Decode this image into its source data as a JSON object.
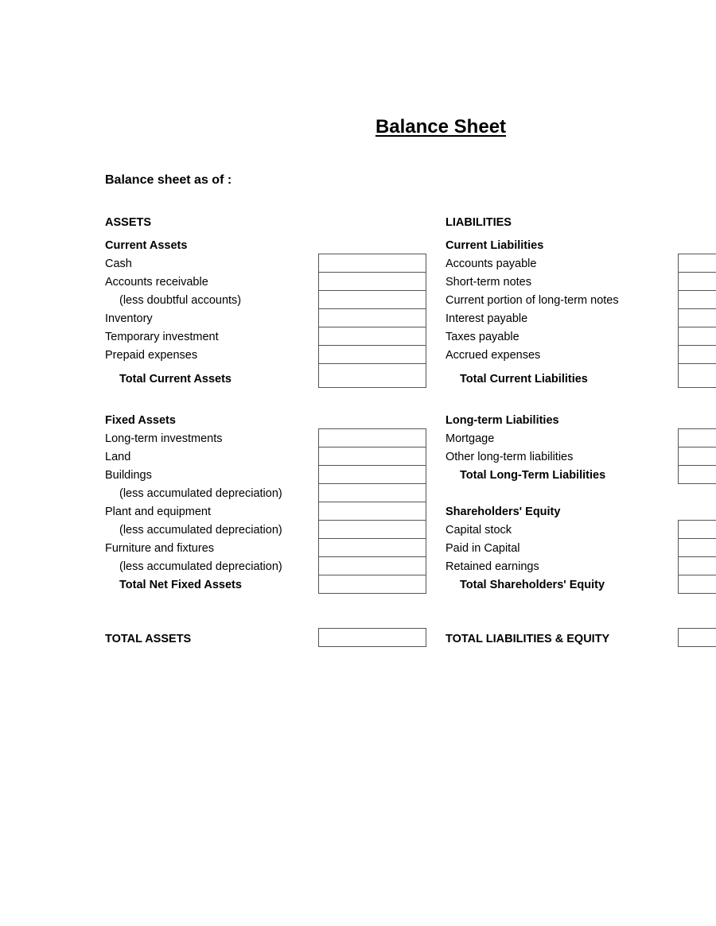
{
  "title": "Balance Sheet",
  "as_of_label": "Balance sheet as of :",
  "assets": {
    "header": "ASSETS",
    "current": {
      "header": "Current Assets",
      "items": [
        {
          "label": "Cash",
          "value": ""
        },
        {
          "label": "Accounts receivable",
          "value": ""
        },
        {
          "label": "(less doubtful accounts)",
          "value": ""
        },
        {
          "label": "Inventory",
          "value": ""
        },
        {
          "label": "Temporary investment",
          "value": ""
        },
        {
          "label": "Prepaid expenses",
          "value": ""
        }
      ],
      "total_label": "Total Current Assets",
      "total_value": ""
    },
    "fixed": {
      "header": "Fixed Assets",
      "items": [
        {
          "label": "Long-term investments",
          "value": ""
        },
        {
          "label": "Land",
          "value": ""
        },
        {
          "label": "Buildings",
          "value": ""
        },
        {
          "label": "(less accumulated depreciation)",
          "value": ""
        },
        {
          "label": "Plant and equipment",
          "value": ""
        },
        {
          "label": "(less accumulated depreciation)",
          "value": ""
        },
        {
          "label": "Furniture and fixtures",
          "value": ""
        },
        {
          "label": "(less accumulated depreciation)",
          "value": ""
        }
      ],
      "total_label": "Total Net Fixed Assets",
      "total_value": ""
    },
    "grand_total_label": "TOTAL ASSETS",
    "grand_total_value": ""
  },
  "liabilities": {
    "header": "LIABILITIES",
    "current": {
      "header": "Current Liabilities",
      "items": [
        {
          "label": "Accounts payable",
          "value": ""
        },
        {
          "label": "Short-term notes",
          "value": ""
        },
        {
          "label": "Current portion of long-term notes",
          "value": ""
        },
        {
          "label": "Interest payable",
          "value": ""
        },
        {
          "label": "Taxes payable",
          "value": ""
        },
        {
          "label": "Accrued expenses",
          "value": ""
        }
      ],
      "total_label": "Total Current Liabilities",
      "total_value": ""
    },
    "long_term": {
      "header": "Long-term Liabilities",
      "items": [
        {
          "label": "Mortgage",
          "value": ""
        },
        {
          "label": "Other long-term liabilities",
          "value": ""
        }
      ],
      "total_label": "Total Long-Term Liabilities",
      "total_value": ""
    },
    "equity": {
      "header": "Shareholders' Equity",
      "items": [
        {
          "label": "Capital stock",
          "value": ""
        },
        {
          "label": "Paid in Capital",
          "value": ""
        },
        {
          "label": "Retained earnings",
          "value": ""
        }
      ],
      "total_label": "Total Shareholders' Equity",
      "total_value": ""
    },
    "grand_total_label": "TOTAL LIABILITIES & EQUITY",
    "grand_total_value": ""
  }
}
